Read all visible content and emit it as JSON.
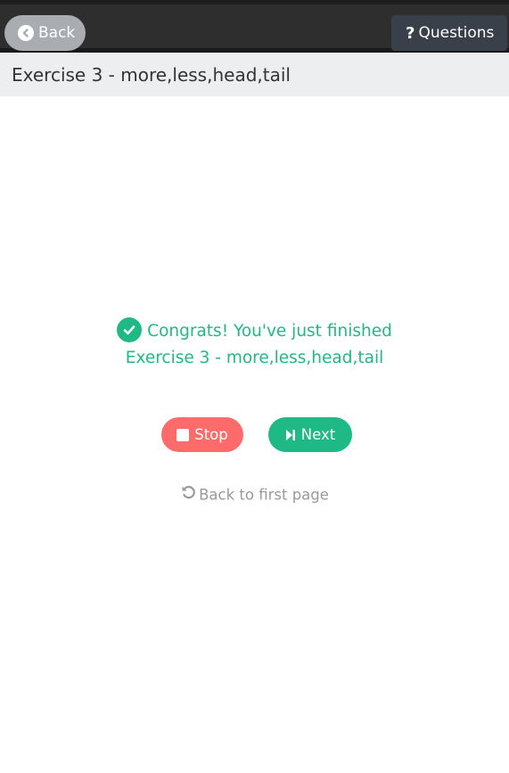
{
  "topbar": {
    "back_label": "Back",
    "questions_label": "Questions"
  },
  "header": {
    "title": "Exercise 3 - more,less,head,tail"
  },
  "result": {
    "line1": "Congrats! You've just finished",
    "line2": "Exercise 3 - more,less,head,tail"
  },
  "actions": {
    "stop_label": "Stop",
    "next_label": "Next",
    "back_first_label": "Back to first page"
  },
  "colors": {
    "accent_green": "#1fb985",
    "stop_red": "#ff6b6b",
    "topbar": "#2e2e2e"
  },
  "icons": {
    "back": "arrow-circle-left-icon",
    "questions": "question-mark-icon",
    "check": "check-circle-icon",
    "stop": "stop-square-icon",
    "next": "step-forward-icon",
    "back_first": "undo-icon"
  }
}
